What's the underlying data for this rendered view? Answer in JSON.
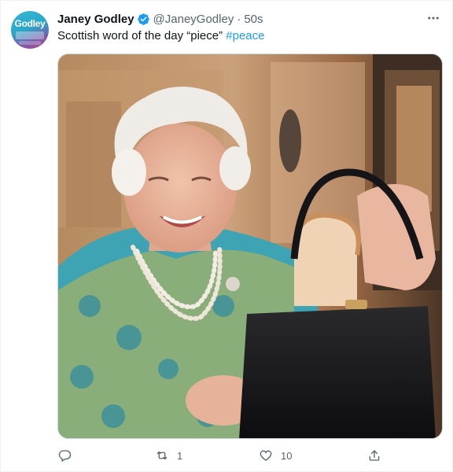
{
  "tweet": {
    "author": {
      "display_name": "Janey Godley",
      "handle": "@JaneyGodley",
      "verified": true,
      "avatar_text": "Godley"
    },
    "separator": "·",
    "time": "50s",
    "text": "Scottish word of the day “piece” ",
    "hashtag": "#peace",
    "more_label": "•••",
    "media": {
      "type": "photo"
    },
    "actions": {
      "reply_count": "",
      "retweet_count": "1",
      "like_count": "10"
    }
  },
  "colors": {
    "link": "#1d9bf0",
    "secondary_text": "#536471",
    "primary_text": "#0f1419",
    "border": "#cfd9de"
  },
  "icons": {
    "verified": "verified-badge-icon",
    "more": "more-dots-icon",
    "reply": "reply-icon",
    "retweet": "retweet-icon",
    "like": "heart-icon",
    "share": "share-icon"
  }
}
